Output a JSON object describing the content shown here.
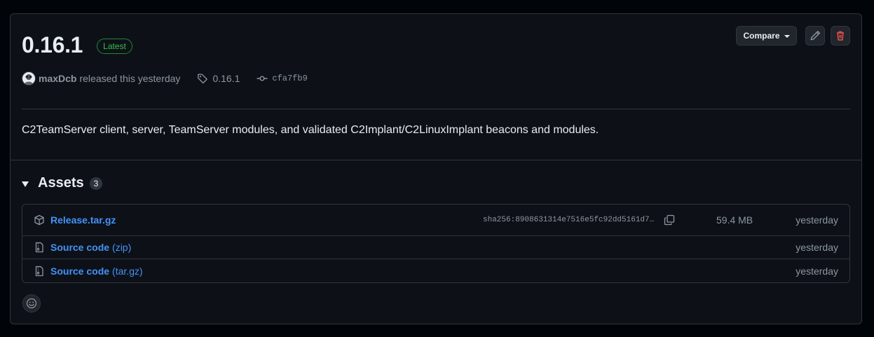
{
  "release": {
    "version": "0.16.1",
    "latest_badge": "Latest",
    "author": "maxDcb",
    "released_text": "released this yesterday",
    "tag": "0.16.1",
    "commit": "cfa7fb9",
    "description": "C2TeamServer client, server, TeamServer modules, and validated C2Implant/C2LinuxImplant beacons and modules."
  },
  "actions": {
    "compare_label": "Compare"
  },
  "assets": {
    "title": "Assets",
    "count": "3",
    "items": [
      {
        "name": "Release.tar.gz",
        "suffix": "",
        "sha": "sha256:8908631314e7516e5fc92dd5161d7…",
        "size": "59.4 MB",
        "time": "yesterday"
      },
      {
        "name": "Source code",
        "suffix": "(zip)",
        "time": "yesterday"
      },
      {
        "name": "Source code",
        "suffix": "(tar.gz)",
        "time": "yesterday"
      }
    ]
  },
  "colors": {
    "accent": "#4493f8",
    "latest": "#3fb950",
    "danger": "#f85149",
    "background": "#0d1117"
  },
  "icons": [
    "pencil-icon",
    "trash-icon",
    "tag-icon",
    "commit-icon",
    "package-icon",
    "file-zip-icon",
    "copy-icon",
    "smiley-icon"
  ]
}
